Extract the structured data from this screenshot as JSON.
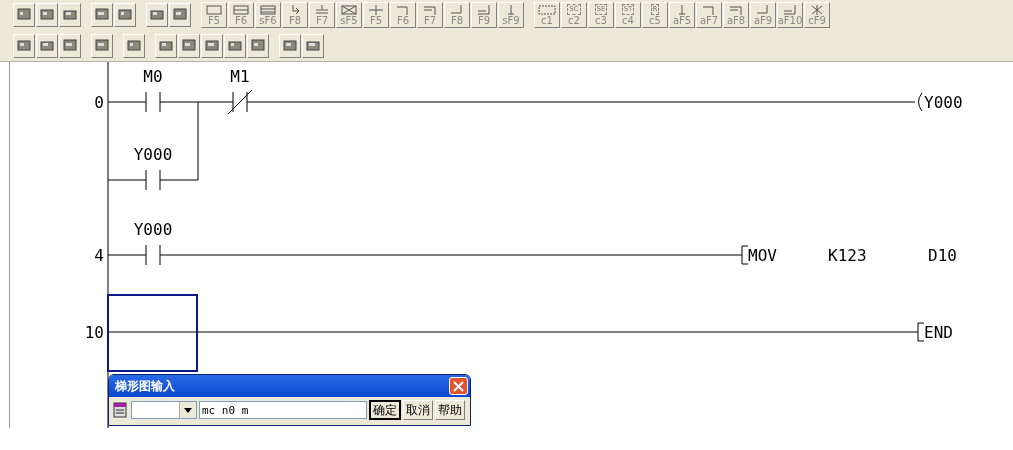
{
  "toolbar": {
    "function_keys": [
      {
        "label": "F5"
      },
      {
        "label": "F6"
      },
      {
        "label": "sF6"
      },
      {
        "label": "F8"
      },
      {
        "label": "F7"
      },
      {
        "label": "sF5"
      },
      {
        "label": "F5"
      },
      {
        "label": "F6"
      },
      {
        "label": "F7"
      },
      {
        "label": "F8"
      },
      {
        "label": "F9"
      },
      {
        "label": "sF9"
      }
    ],
    "comment_keys": [
      {
        "label": "c1"
      },
      {
        "label": "c2",
        "tag": "SC"
      },
      {
        "label": "c3",
        "tag": "SE"
      },
      {
        "label": "c4",
        "tag": "ST"
      },
      {
        "label": "c5",
        "tag": "R"
      },
      {
        "label": "aF5"
      },
      {
        "label": "aF7"
      },
      {
        "label": "aF8"
      },
      {
        "label": "aF9"
      },
      {
        "label": "aF10"
      },
      {
        "label": "cF9"
      }
    ]
  },
  "ladder": {
    "rungs": [
      {
        "step": "0",
        "rows": [
          {
            "contacts": [
              {
                "kind": "no",
                "device": "M0"
              },
              {
                "kind": "nc",
                "device": "M1"
              }
            ]
          },
          {
            "contacts": [
              {
                "kind": "no",
                "device": "Y000"
              }
            ]
          }
        ],
        "output": {
          "kind": "coil",
          "operands": [
            "Y000"
          ]
        },
        "cursor": false
      },
      {
        "step": "4",
        "rows": [
          {
            "contacts": [
              {
                "kind": "no",
                "device": "Y000"
              }
            ]
          }
        ],
        "output": {
          "kind": "instruction",
          "operands": [
            "MOV",
            "K123",
            "D10"
          ]
        },
        "cursor": false
      },
      {
        "step": "10",
        "rows": [
          {
            "contacts": []
          }
        ],
        "output": {
          "kind": "instruction",
          "operands": [
            "END"
          ]
        },
        "cursor": true
      }
    ]
  },
  "dialog": {
    "title": "梯形图输入",
    "input": {
      "value": "mc n0 m"
    },
    "buttons": [
      {
        "label": "确定",
        "default": true
      },
      {
        "label": "取消",
        "default": false
      },
      {
        "label": "帮助",
        "default": false
      }
    ]
  }
}
